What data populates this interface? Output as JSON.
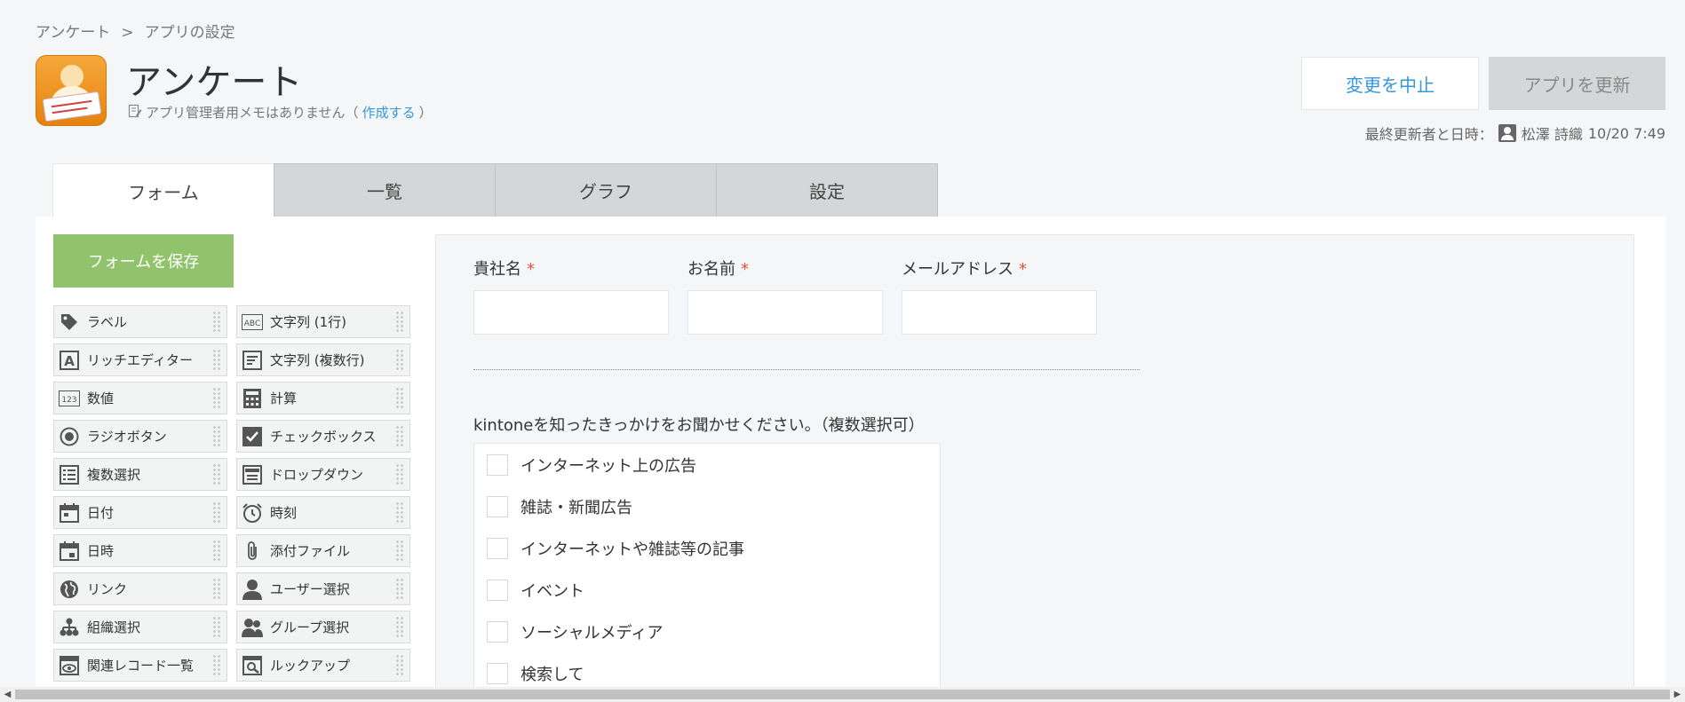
{
  "breadcrumb": {
    "items": [
      "アンケート",
      "アプリの設定"
    ],
    "separator": ">"
  },
  "app": {
    "icon": "survey-app-icon",
    "title": "アンケート",
    "memo_text": "アプリ管理者用メモはありません（",
    "memo_link": "作成する",
    "memo_close": "）"
  },
  "header": {
    "cancel_label": "変更を中止",
    "update_label": "アプリを更新",
    "last_update_label": "最終更新者と日時：",
    "last_update_user": "松澤 詩織",
    "last_update_time": "10/20 7:49"
  },
  "tabs": [
    {
      "label": "フォーム",
      "active": true
    },
    {
      "label": "一覧",
      "active": false
    },
    {
      "label": "グラフ",
      "active": false
    },
    {
      "label": "設定",
      "active": false
    }
  ],
  "save_form_label": "フォームを保存",
  "palette": [
    {
      "label": "ラベル",
      "icon": "tag-icon"
    },
    {
      "label": "文字列 (1行)",
      "icon": "abc-icon"
    },
    {
      "label": "リッチエディター",
      "icon": "rich-editor-icon"
    },
    {
      "label": "文字列 (複数行)",
      "icon": "multiline-icon"
    },
    {
      "label": "数値",
      "icon": "number-icon"
    },
    {
      "label": "計算",
      "icon": "calculator-icon"
    },
    {
      "label": "ラジオボタン",
      "icon": "radio-icon"
    },
    {
      "label": "チェックボックス",
      "icon": "checkbox-icon"
    },
    {
      "label": "複数選択",
      "icon": "multi-select-icon"
    },
    {
      "label": "ドロップダウン",
      "icon": "dropdown-icon"
    },
    {
      "label": "日付",
      "icon": "calendar-icon"
    },
    {
      "label": "時刻",
      "icon": "clock-icon"
    },
    {
      "label": "日時",
      "icon": "datetime-icon"
    },
    {
      "label": "添付ファイル",
      "icon": "paperclip-icon"
    },
    {
      "label": "リンク",
      "icon": "globe-icon"
    },
    {
      "label": "ユーザー選択",
      "icon": "user-icon"
    },
    {
      "label": "組織選択",
      "icon": "org-icon"
    },
    {
      "label": "グループ選択",
      "icon": "group-icon"
    },
    {
      "label": "関連レコード一覧",
      "icon": "related-records-icon"
    },
    {
      "label": "ルックアップ",
      "icon": "lookup-icon"
    }
  ],
  "form": {
    "fields": [
      {
        "label": "貴社名",
        "required_mark": "*"
      },
      {
        "label": "お名前",
        "required_mark": "*"
      },
      {
        "label": "メールアドレス",
        "required_mark": "*"
      }
    ],
    "checkbox_question": "kintoneを知ったきっかけをお聞かせください。（複数選択可）",
    "checkbox_options": [
      "インターネット上の広告",
      "雑誌・新聞広告",
      "インターネットや雑誌等の記事",
      "イベント",
      "ソーシャルメディア",
      "検索して"
    ]
  },
  "colors": {
    "accent_blue": "#3498db",
    "save_green": "#91c36c",
    "required_red": "#e74c3c",
    "tab_inactive": "#d4d7d7"
  }
}
